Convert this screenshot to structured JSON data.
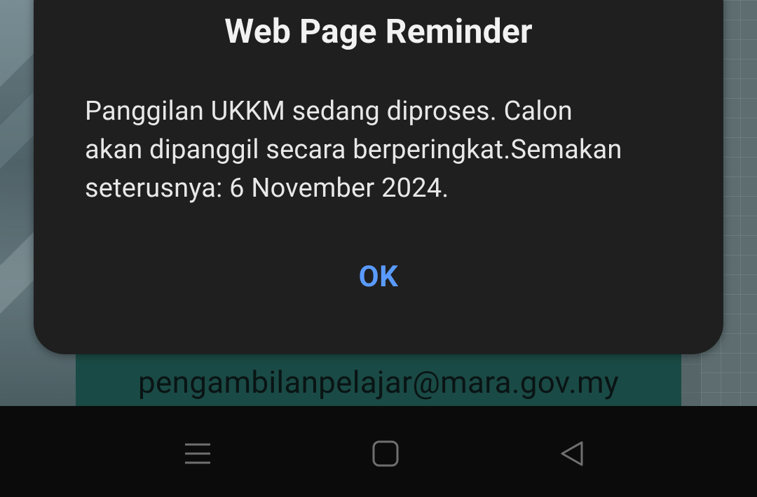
{
  "background_page": {
    "email": "pengambilanpelajar@mara.gov.my"
  },
  "dialog": {
    "title": "Web Page Reminder",
    "message_lines": [
      "Panggilan UKKM sedang diproses. Calon",
      "akan dipanggil secara berperingkat.Semakan",
      "seterusnya: 6 November 2024."
    ],
    "ok_label": "OK",
    "accent_color": "#5a9bff"
  },
  "navigation_bar": {
    "buttons": [
      {
        "name": "menu",
        "icon": "menu-icon"
      },
      {
        "name": "home",
        "icon": "square-icon"
      },
      {
        "name": "back",
        "icon": "triangle-back-icon"
      }
    ]
  }
}
